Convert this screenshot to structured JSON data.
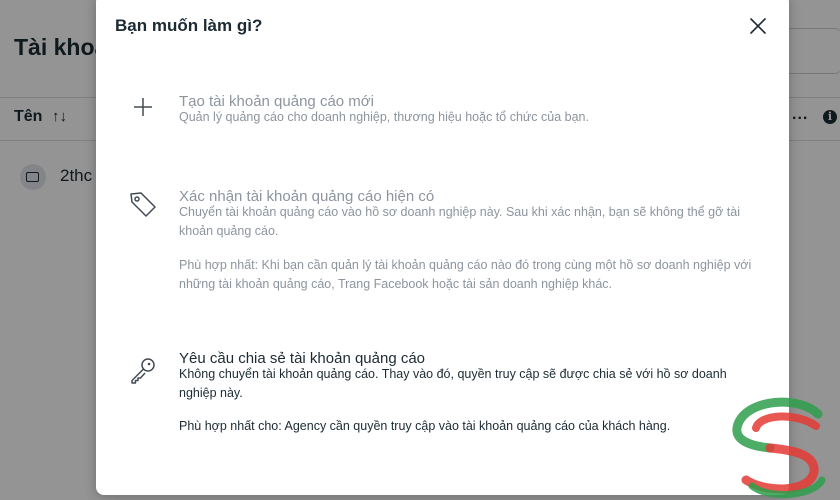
{
  "background": {
    "page_title": "Tài khoả",
    "column_name": "Tên",
    "sort_icon": "↑↓",
    "more_label": "...",
    "info_icon": "i",
    "row_text": "2thc"
  },
  "modal": {
    "title": "Bạn muốn làm gì?",
    "close_icon": "close-icon",
    "options": [
      {
        "icon": "plus-icon",
        "title": "Tạo tài khoản quảng cáo mới",
        "description": "Quản lý quảng cáo cho doanh nghiệp, thương hiệu hoặc tổ chức của bạn.",
        "enabled": false
      },
      {
        "icon": "tag-icon",
        "title": "Xác nhận tài khoản quảng cáo hiện có",
        "description": "Chuyển tài khoản quảng cáo vào hồ sơ doanh nghiệp này. Sau khi xác nhận, bạn sẽ không thể gỡ tài khoản quảng cáo.",
        "note": "Phù hợp nhất: Khi bạn cần quản lý tài khoản quảng cáo nào đó trong cùng một hồ sơ doanh nghiệp với những tài khoản quảng cáo, Trang Facebook hoặc tài sản doanh nghiệp khác.",
        "enabled": false
      },
      {
        "icon": "key-icon",
        "title": "Yêu cầu chia sẻ tài khoản quảng cáo",
        "description": "Không chuyển tài khoản quảng cáo. Thay vào đó, quyền truy cập sẽ được chia sẻ với hồ sơ doanh nghiệp này.",
        "note": "Phù hợp nhất cho: Agency cần quyền truy cập vào tài khoản quảng cáo của khách hàng.",
        "enabled": true
      }
    ]
  },
  "colors": {
    "text_primary": "#1c2b33",
    "text_disabled": "#8d949e",
    "overlay": "rgba(0,0,0,0.42)",
    "logo_green": "#2e9e4a",
    "logo_red": "#e53935"
  }
}
